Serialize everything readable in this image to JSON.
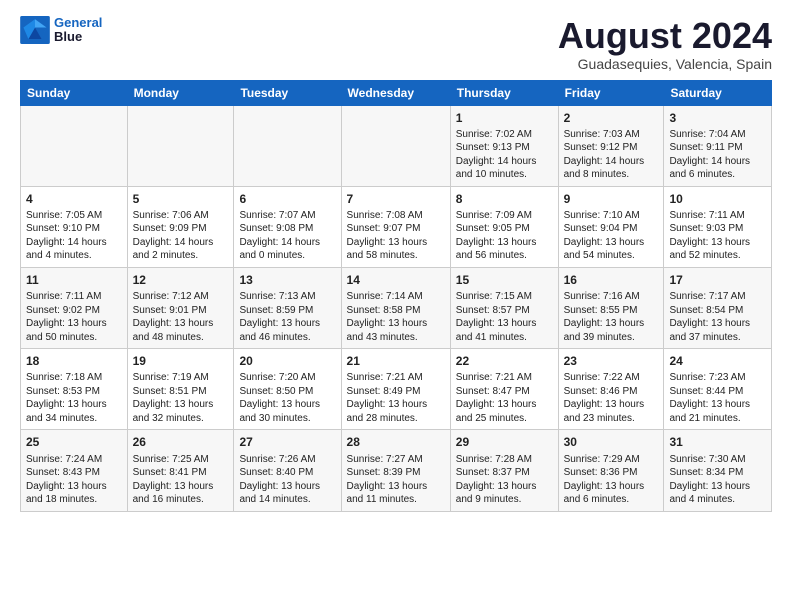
{
  "header": {
    "logo_line1": "General",
    "logo_line2": "Blue",
    "main_title": "August 2024",
    "subtitle": "Guadasequies, Valencia, Spain"
  },
  "weekdays": [
    "Sunday",
    "Monday",
    "Tuesday",
    "Wednesday",
    "Thursday",
    "Friday",
    "Saturday"
  ],
  "weeks": [
    [
      {
        "day": "",
        "info": ""
      },
      {
        "day": "",
        "info": ""
      },
      {
        "day": "",
        "info": ""
      },
      {
        "day": "",
        "info": ""
      },
      {
        "day": "1",
        "info": "Sunrise: 7:02 AM\nSunset: 9:13 PM\nDaylight: 14 hours\nand 10 minutes."
      },
      {
        "day": "2",
        "info": "Sunrise: 7:03 AM\nSunset: 9:12 PM\nDaylight: 14 hours\nand 8 minutes."
      },
      {
        "day": "3",
        "info": "Sunrise: 7:04 AM\nSunset: 9:11 PM\nDaylight: 14 hours\nand 6 minutes."
      }
    ],
    [
      {
        "day": "4",
        "info": "Sunrise: 7:05 AM\nSunset: 9:10 PM\nDaylight: 14 hours\nand 4 minutes."
      },
      {
        "day": "5",
        "info": "Sunrise: 7:06 AM\nSunset: 9:09 PM\nDaylight: 14 hours\nand 2 minutes."
      },
      {
        "day": "6",
        "info": "Sunrise: 7:07 AM\nSunset: 9:08 PM\nDaylight: 14 hours\nand 0 minutes."
      },
      {
        "day": "7",
        "info": "Sunrise: 7:08 AM\nSunset: 9:07 PM\nDaylight: 13 hours\nand 58 minutes."
      },
      {
        "day": "8",
        "info": "Sunrise: 7:09 AM\nSunset: 9:05 PM\nDaylight: 13 hours\nand 56 minutes."
      },
      {
        "day": "9",
        "info": "Sunrise: 7:10 AM\nSunset: 9:04 PM\nDaylight: 13 hours\nand 54 minutes."
      },
      {
        "day": "10",
        "info": "Sunrise: 7:11 AM\nSunset: 9:03 PM\nDaylight: 13 hours\nand 52 minutes."
      }
    ],
    [
      {
        "day": "11",
        "info": "Sunrise: 7:11 AM\nSunset: 9:02 PM\nDaylight: 13 hours\nand 50 minutes."
      },
      {
        "day": "12",
        "info": "Sunrise: 7:12 AM\nSunset: 9:01 PM\nDaylight: 13 hours\nand 48 minutes."
      },
      {
        "day": "13",
        "info": "Sunrise: 7:13 AM\nSunset: 8:59 PM\nDaylight: 13 hours\nand 46 minutes."
      },
      {
        "day": "14",
        "info": "Sunrise: 7:14 AM\nSunset: 8:58 PM\nDaylight: 13 hours\nand 43 minutes."
      },
      {
        "day": "15",
        "info": "Sunrise: 7:15 AM\nSunset: 8:57 PM\nDaylight: 13 hours\nand 41 minutes."
      },
      {
        "day": "16",
        "info": "Sunrise: 7:16 AM\nSunset: 8:55 PM\nDaylight: 13 hours\nand 39 minutes."
      },
      {
        "day": "17",
        "info": "Sunrise: 7:17 AM\nSunset: 8:54 PM\nDaylight: 13 hours\nand 37 minutes."
      }
    ],
    [
      {
        "day": "18",
        "info": "Sunrise: 7:18 AM\nSunset: 8:53 PM\nDaylight: 13 hours\nand 34 minutes."
      },
      {
        "day": "19",
        "info": "Sunrise: 7:19 AM\nSunset: 8:51 PM\nDaylight: 13 hours\nand 32 minutes."
      },
      {
        "day": "20",
        "info": "Sunrise: 7:20 AM\nSunset: 8:50 PM\nDaylight: 13 hours\nand 30 minutes."
      },
      {
        "day": "21",
        "info": "Sunrise: 7:21 AM\nSunset: 8:49 PM\nDaylight: 13 hours\nand 28 minutes."
      },
      {
        "day": "22",
        "info": "Sunrise: 7:21 AM\nSunset: 8:47 PM\nDaylight: 13 hours\nand 25 minutes."
      },
      {
        "day": "23",
        "info": "Sunrise: 7:22 AM\nSunset: 8:46 PM\nDaylight: 13 hours\nand 23 minutes."
      },
      {
        "day": "24",
        "info": "Sunrise: 7:23 AM\nSunset: 8:44 PM\nDaylight: 13 hours\nand 21 minutes."
      }
    ],
    [
      {
        "day": "25",
        "info": "Sunrise: 7:24 AM\nSunset: 8:43 PM\nDaylight: 13 hours\nand 18 minutes."
      },
      {
        "day": "26",
        "info": "Sunrise: 7:25 AM\nSunset: 8:41 PM\nDaylight: 13 hours\nand 16 minutes."
      },
      {
        "day": "27",
        "info": "Sunrise: 7:26 AM\nSunset: 8:40 PM\nDaylight: 13 hours\nand 14 minutes."
      },
      {
        "day": "28",
        "info": "Sunrise: 7:27 AM\nSunset: 8:39 PM\nDaylight: 13 hours\nand 11 minutes."
      },
      {
        "day": "29",
        "info": "Sunrise: 7:28 AM\nSunset: 8:37 PM\nDaylight: 13 hours\nand 9 minutes."
      },
      {
        "day": "30",
        "info": "Sunrise: 7:29 AM\nSunset: 8:36 PM\nDaylight: 13 hours\nand 6 minutes."
      },
      {
        "day": "31",
        "info": "Sunrise: 7:30 AM\nSunset: 8:34 PM\nDaylight: 13 hours\nand 4 minutes."
      }
    ]
  ]
}
